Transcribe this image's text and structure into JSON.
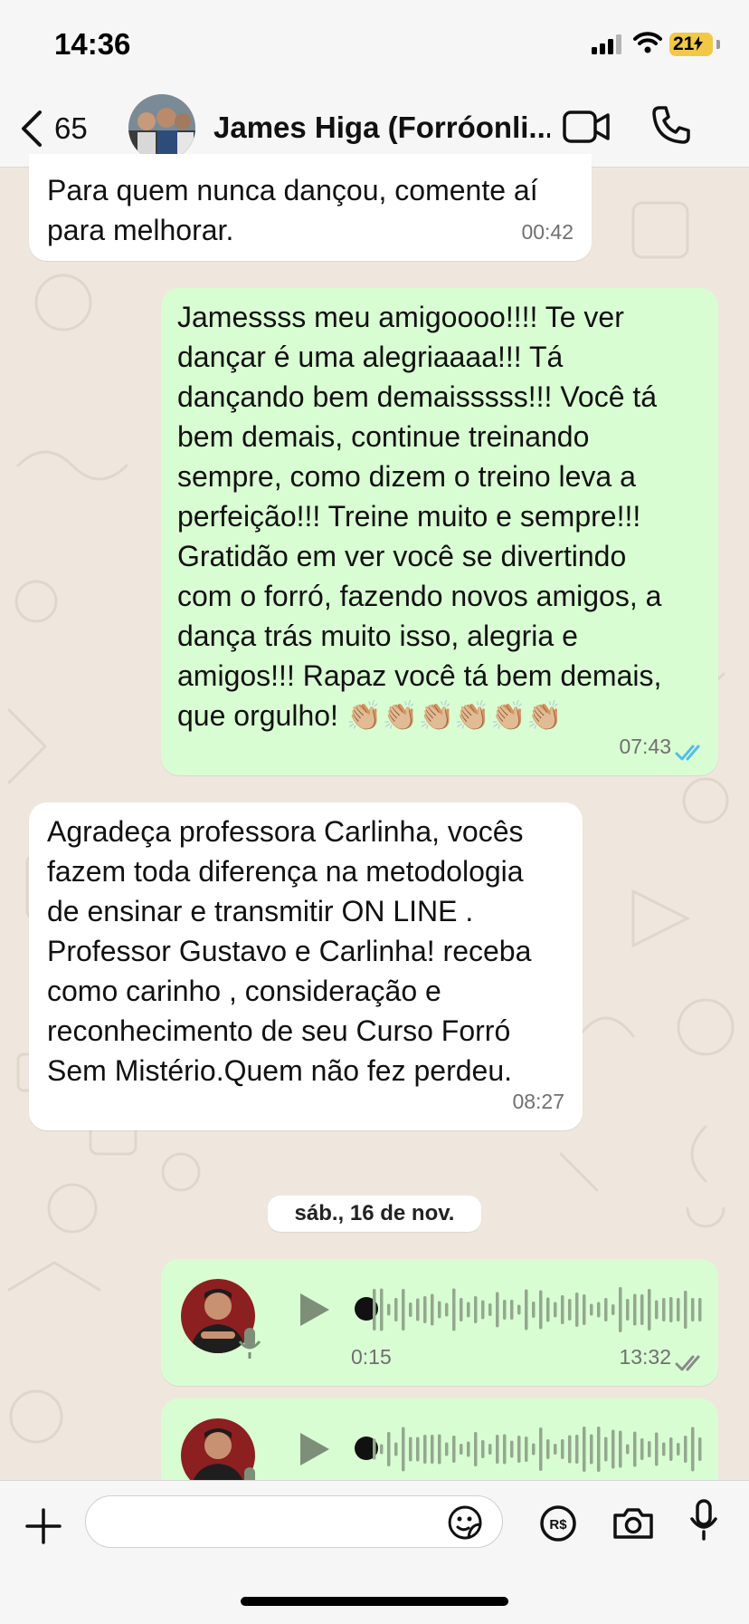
{
  "status_bar": {
    "time": "14:36",
    "battery": "21"
  },
  "header": {
    "back_count": "65",
    "contact_name": "James Higa (Forróonli..."
  },
  "messages": [
    {
      "direction": "in",
      "text": "Para quem nunca dançou, comente aí\npara melhorar.",
      "time": "00:42"
    },
    {
      "direction": "out",
      "text": "Jamessss meu amigoooo!!!! Te ver\ndançar é uma alegriaaaa!!! Tá\ndançando bem demaisssss!!! Você tá\nbem demais, continue treinando\nsempre, como dizem o treino leva a\nperfeição!!! Treine muito e sempre!!!\nGratidão em ver você se divertindo\ncom o forró, fazendo novos amigos, a\ndança trás muito isso, alegria e\namigos!!! Rapaz você tá bem demais,\nque orgulho! 👏🏼👏🏼👏🏼👏🏼👏🏼👏🏼",
      "time": "07:43",
      "read": true
    },
    {
      "direction": "in",
      "text": "Agradeça professora Carlinha, vocês\nfazem toda diferença na metodologia\nde ensinar e transmitir ON LINE .\nProfessor Gustavo e Carlinha! receba\ncomo carinho , consideração e\nreconhecimento de seu Curso Forró\nSem Mistério.Quem não fez perdeu.",
      "time": "08:27"
    }
  ],
  "date_separator": "sáb., 16 de nov.",
  "voice_messages": [
    {
      "duration": "0:15",
      "time": "13:32",
      "read": false
    },
    {
      "duration": "",
      "time": ""
    }
  ],
  "input": {
    "placeholder": ""
  },
  "colors": {
    "outgoing_bubble": "#d9fdd3",
    "incoming_bubble": "#ffffff",
    "read_tick": "#53bdeb",
    "chat_background": "#efe7de"
  },
  "icons": [
    "back-chevron-icon",
    "video-call-icon",
    "phone-icon",
    "plus-icon",
    "sticker-icon",
    "payment-icon",
    "camera-icon",
    "microphone-icon",
    "play-icon"
  ]
}
